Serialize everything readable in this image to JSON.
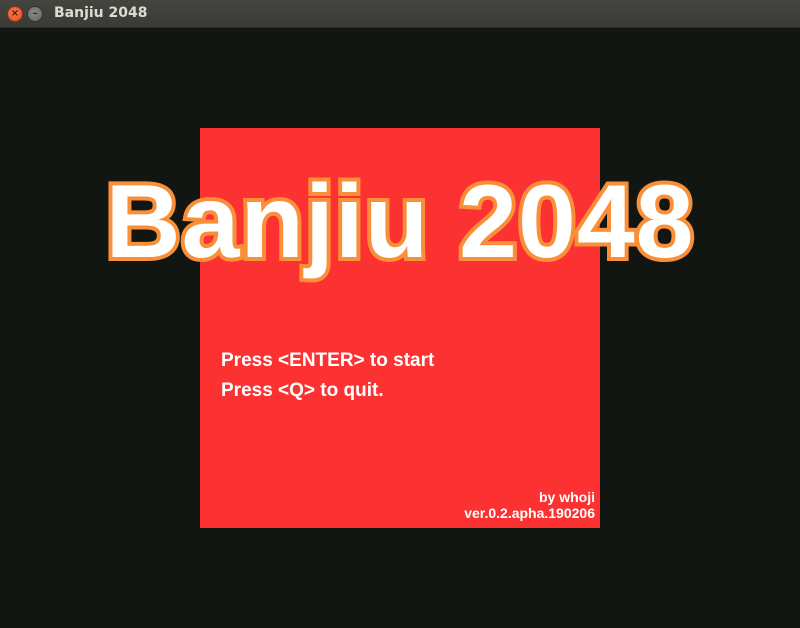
{
  "window": {
    "title": "Banjiu 2048",
    "close_glyph": "×",
    "minimize_glyph": "–"
  },
  "game": {
    "title": "Banjiu 2048",
    "instructions": [
      "Press <ENTER> to start",
      "Press <Q> to quit."
    ],
    "author": "by whoji",
    "version": "ver.0.2.apha.190206"
  },
  "colors": {
    "background": "#121612",
    "panel": "#fc3232",
    "title_fill": "#ffffff",
    "title_outline": "#f98f38",
    "text": "#ffffff"
  },
  "icons": [
    "close-icon",
    "minimize-icon"
  ]
}
